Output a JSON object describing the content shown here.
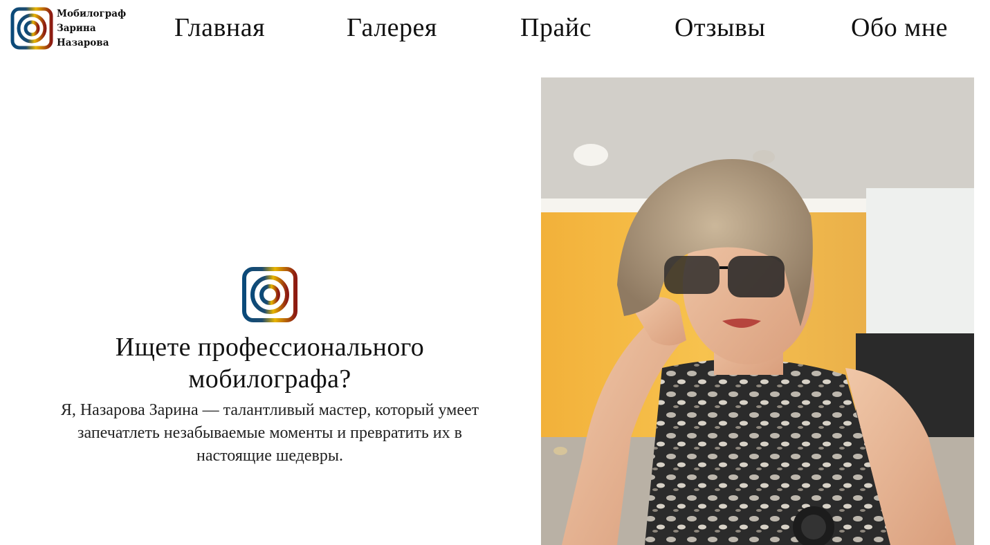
{
  "brand": {
    "logo_icon": "camera-lens-icon",
    "name_line1": "Мобилограф",
    "name_line2": "Зарина",
    "name_line3": "Назарова"
  },
  "nav": {
    "items": [
      {
        "label": "Главная"
      },
      {
        "label": "Галерея"
      },
      {
        "label": "Прайс"
      },
      {
        "label": "Отзывы"
      },
      {
        "label": "Обо мне"
      }
    ]
  },
  "hero": {
    "logo_icon": "camera-lens-icon",
    "title_line1": "Ищете профессионального",
    "title_line2": "мобилографа?",
    "desc_line1": "Я, Назарова Зарина — талантливый мастер, который умеет",
    "desc_line2": "запечатлеть незабываемые моменты и превратить их в",
    "desc_line3": "настоящие шедевры.",
    "photo_subject": "portrait-photo"
  },
  "colors": {
    "gradient_start": "#0a4a7a",
    "gradient_mid": "#e0b400",
    "gradient_end": "#8a1a14",
    "text": "#111111",
    "background": "#ffffff"
  }
}
